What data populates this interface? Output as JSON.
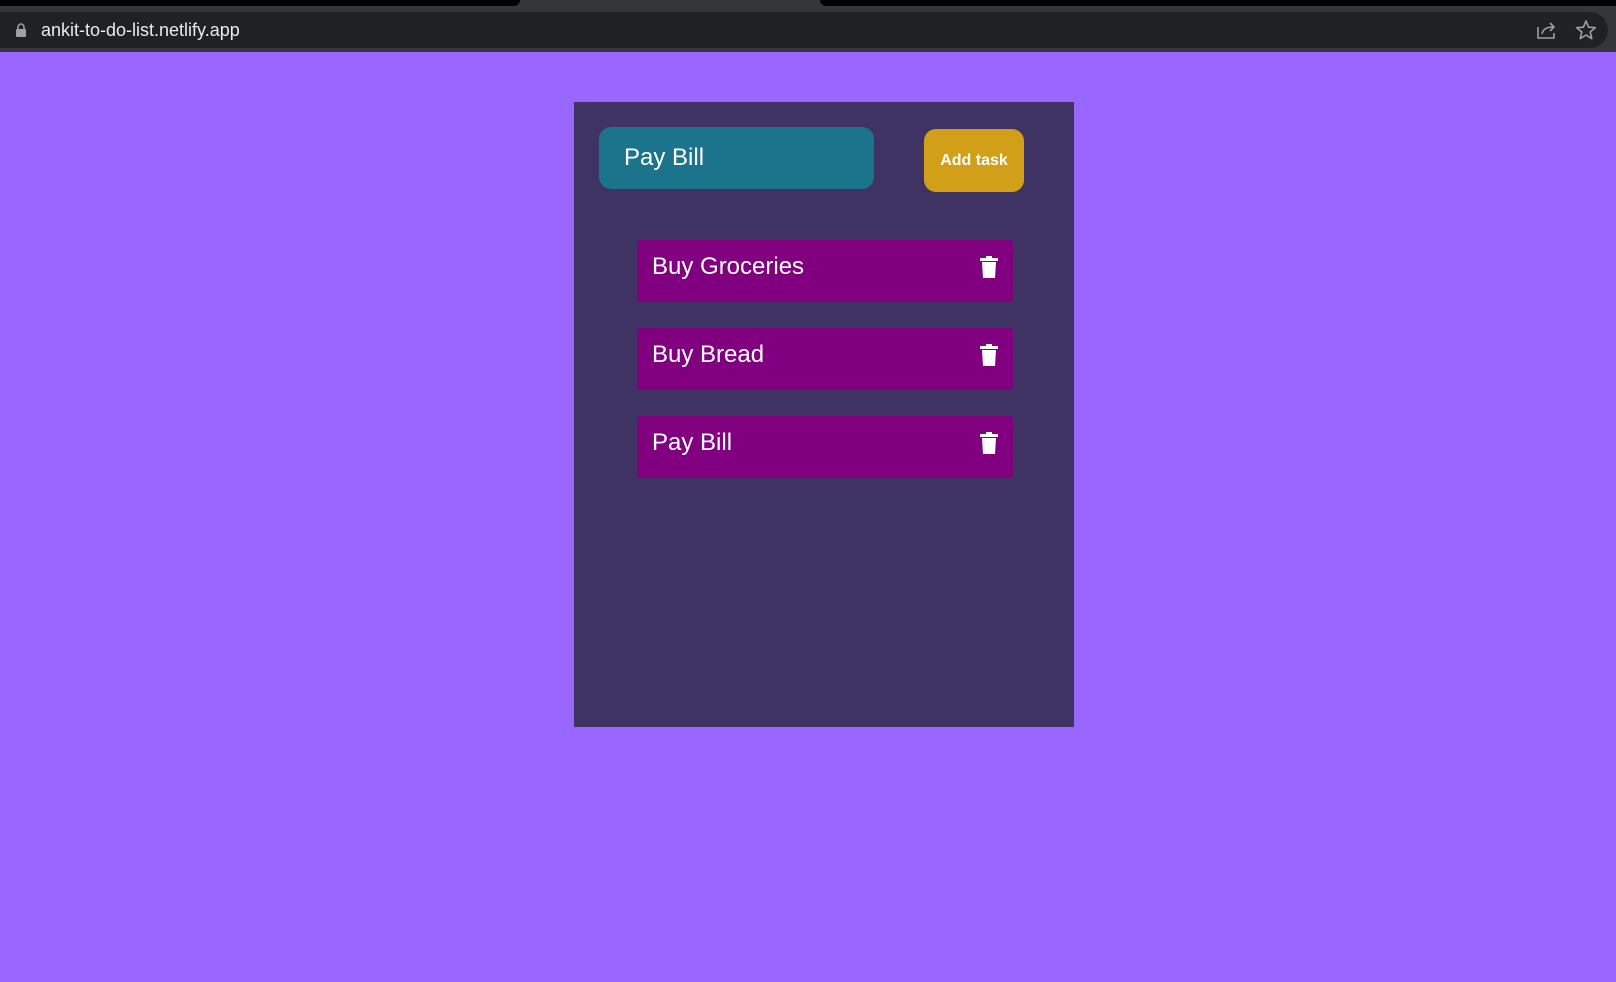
{
  "browser": {
    "url": "ankit-to-do-list.netlify.app",
    "icons": [
      "lock-icon",
      "share-icon",
      "star-icon"
    ]
  },
  "app": {
    "input": {
      "value": "Pay Bill"
    },
    "add_button_label": "Add task",
    "tasks": [
      {
        "label": "Buy Groceries",
        "icon": "trash-icon"
      },
      {
        "label": "Buy Bread",
        "icon": "trash-icon"
      },
      {
        "label": "Pay Bill",
        "icon": "trash-icon"
      }
    ]
  },
  "colors": {
    "page_background": "#9966ff",
    "card_background": "#3f3363",
    "input_background": "#1c738c",
    "button_background": "#d1a018",
    "task_background": "#800080",
    "text": "#ffffff"
  }
}
